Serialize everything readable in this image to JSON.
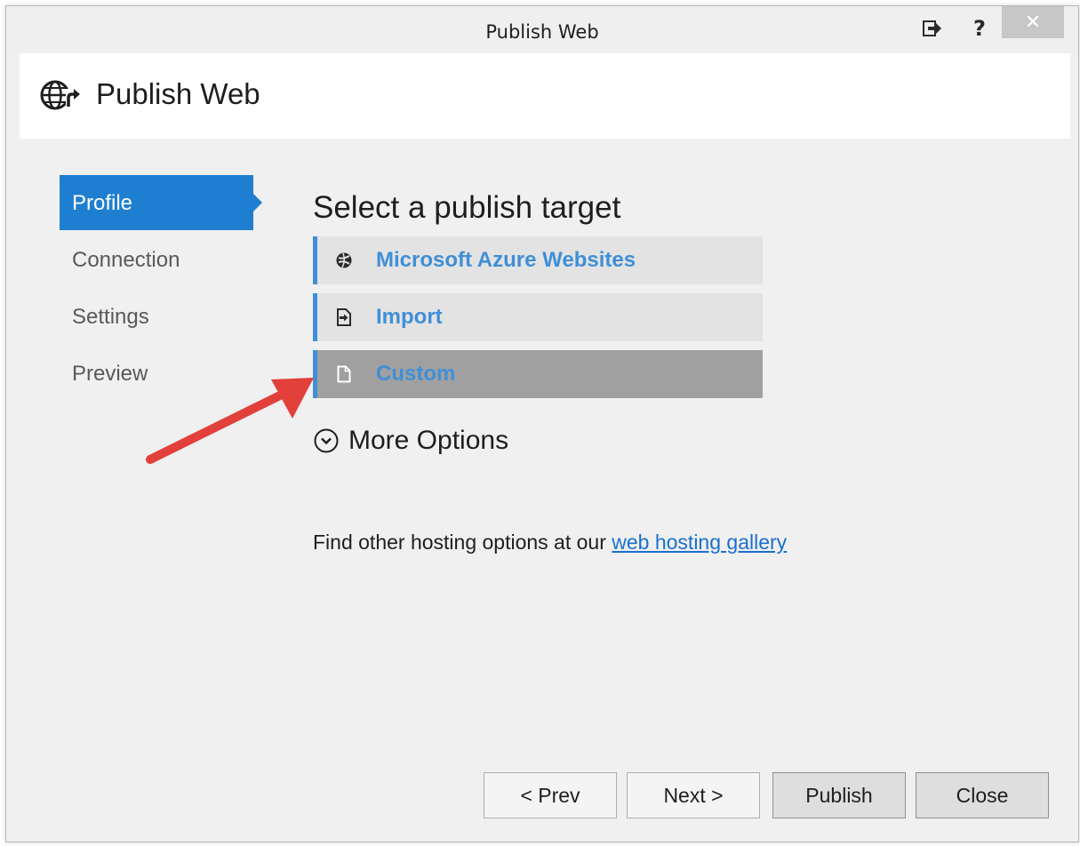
{
  "window": {
    "title": "Publish Web",
    "icons": [
      "export-icon",
      "help-icon",
      "close-icon"
    ],
    "help_glyph": "?",
    "close_glyph": "✕"
  },
  "header": {
    "title": "Publish Web",
    "icon": "globe-publish-icon"
  },
  "nav": {
    "items": [
      {
        "label": "Profile",
        "active": true
      },
      {
        "label": "Connection",
        "active": false
      },
      {
        "label": "Settings",
        "active": false
      },
      {
        "label": "Preview",
        "active": false
      }
    ]
  },
  "main": {
    "section_title": "Select a publish target",
    "targets": [
      {
        "label": "Microsoft Azure Websites",
        "icon": "azure-icon",
        "selected": false
      },
      {
        "label": "Import",
        "icon": "import-icon",
        "selected": false
      },
      {
        "label": "Custom",
        "icon": "document-icon",
        "selected": true
      }
    ],
    "more_options": "More Options",
    "hosting_text": "Find other hosting options at our ",
    "hosting_link": "web hosting gallery"
  },
  "buttons": {
    "prev": "< Prev",
    "next": "Next >",
    "publish": "Publish",
    "close": "Close"
  },
  "colors": {
    "accent": "#1e7fd1",
    "link": "#3f8fd8",
    "selected_row": "#a0a0a0",
    "annotation_arrow": "#e2403a"
  }
}
